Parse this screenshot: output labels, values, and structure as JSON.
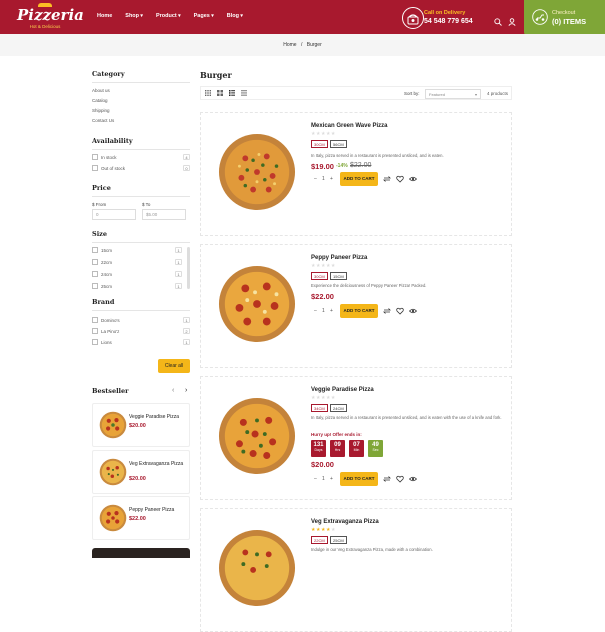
{
  "header": {
    "logo_title": "Pizzeria",
    "logo_sub": "Hot & Delicious",
    "nav": [
      "Home",
      "Shop",
      "Product",
      "Pages",
      "Blog"
    ],
    "delivery_label": "Call on Delivery",
    "delivery_phone": "54 548 779 654",
    "cart_label": "Checkout",
    "cart_items": "(0) ITEMS"
  },
  "breadcrumb": {
    "home": "Home",
    "sep": "/",
    "current": "Burger"
  },
  "sidebar": {
    "category_title": "Category",
    "categories": [
      "About us",
      "Catalog",
      "Shipping",
      "Contact Us"
    ],
    "availability_title": "Availability",
    "availability": [
      {
        "label": "In stock",
        "count": "4"
      },
      {
        "label": "Out of stock",
        "count": "0"
      }
    ],
    "price_title": "Price",
    "price_from_label": "$ From",
    "price_to_label": "$ To",
    "price_from_placeholder": "0",
    "price_to_placeholder": "$5.00",
    "size_title": "Size",
    "sizes": [
      {
        "label": "15cm",
        "count": "1"
      },
      {
        "label": "22cm",
        "count": "1"
      },
      {
        "label": "24cm",
        "count": "1"
      },
      {
        "label": "25cm",
        "count": "1"
      }
    ],
    "brand_title": "Brand",
    "brands": [
      {
        "label": "Domino's",
        "count": "1"
      },
      {
        "label": "La Pino'z",
        "count": "2"
      },
      {
        "label": "Lions",
        "count": "1"
      }
    ],
    "clear_label": "Clear all",
    "bestseller_title": "Bestseller",
    "bestsellers": [
      {
        "name": "Veggie Paradise Pizza",
        "price": "$20.00"
      },
      {
        "name": "Veg Extravaganza Pizza",
        "price": "$20.00"
      },
      {
        "name": "Peppy Paneer Pizza",
        "price": "$22.00"
      }
    ]
  },
  "main": {
    "title": "Burger",
    "sort_label": "Sort by:",
    "sort_value": "Featured",
    "product_count": "4 products",
    "add_label": "ADD TO CART",
    "qty": "1",
    "products": [
      {
        "name": "Mexican Green Wave Pizza",
        "sizes": [
          "30CM",
          "56CM"
        ],
        "desc": "In Italy, pizza served in a restaurant is presented unsliced, and is eaten.",
        "price": "$19.00",
        "discount": "-14%",
        "old": "$22.00",
        "rating": 0
      },
      {
        "name": "Peppy Paneer Pizza",
        "sizes": [
          "30CM",
          "15CM"
        ],
        "desc": "Experience the deliciousness of Peppy Paneer Pizza! Packed.",
        "price": "$22.00",
        "rating": 0
      },
      {
        "name": "Veggie Paradise Pizza",
        "sizes": [
          "34CM",
          "24CM"
        ],
        "desc": "In Italy, pizza served in a restaurant is presented unsliced, and is eaten with the use of a knife and fork.",
        "hurry": "Hurry up! Offer ends in:",
        "timer": [
          {
            "v": "131",
            "u": "Days"
          },
          {
            "v": "09",
            "u": "Hrs"
          },
          {
            "v": "07",
            "u": "Min"
          },
          {
            "v": "49",
            "u": "Sec"
          }
        ],
        "price": "$20.00",
        "rating": 0
      },
      {
        "name": "Veg Extravaganza Pizza",
        "sizes": [
          "22CM",
          "25CM"
        ],
        "desc": "Indulge in our Veg Extravaganza Pizza, made with a combination.",
        "rating": 4
      }
    ]
  },
  "colors": {
    "brand_red": "#a8192e",
    "accent_yellow": "#f4b619",
    "green": "#7fa637"
  }
}
